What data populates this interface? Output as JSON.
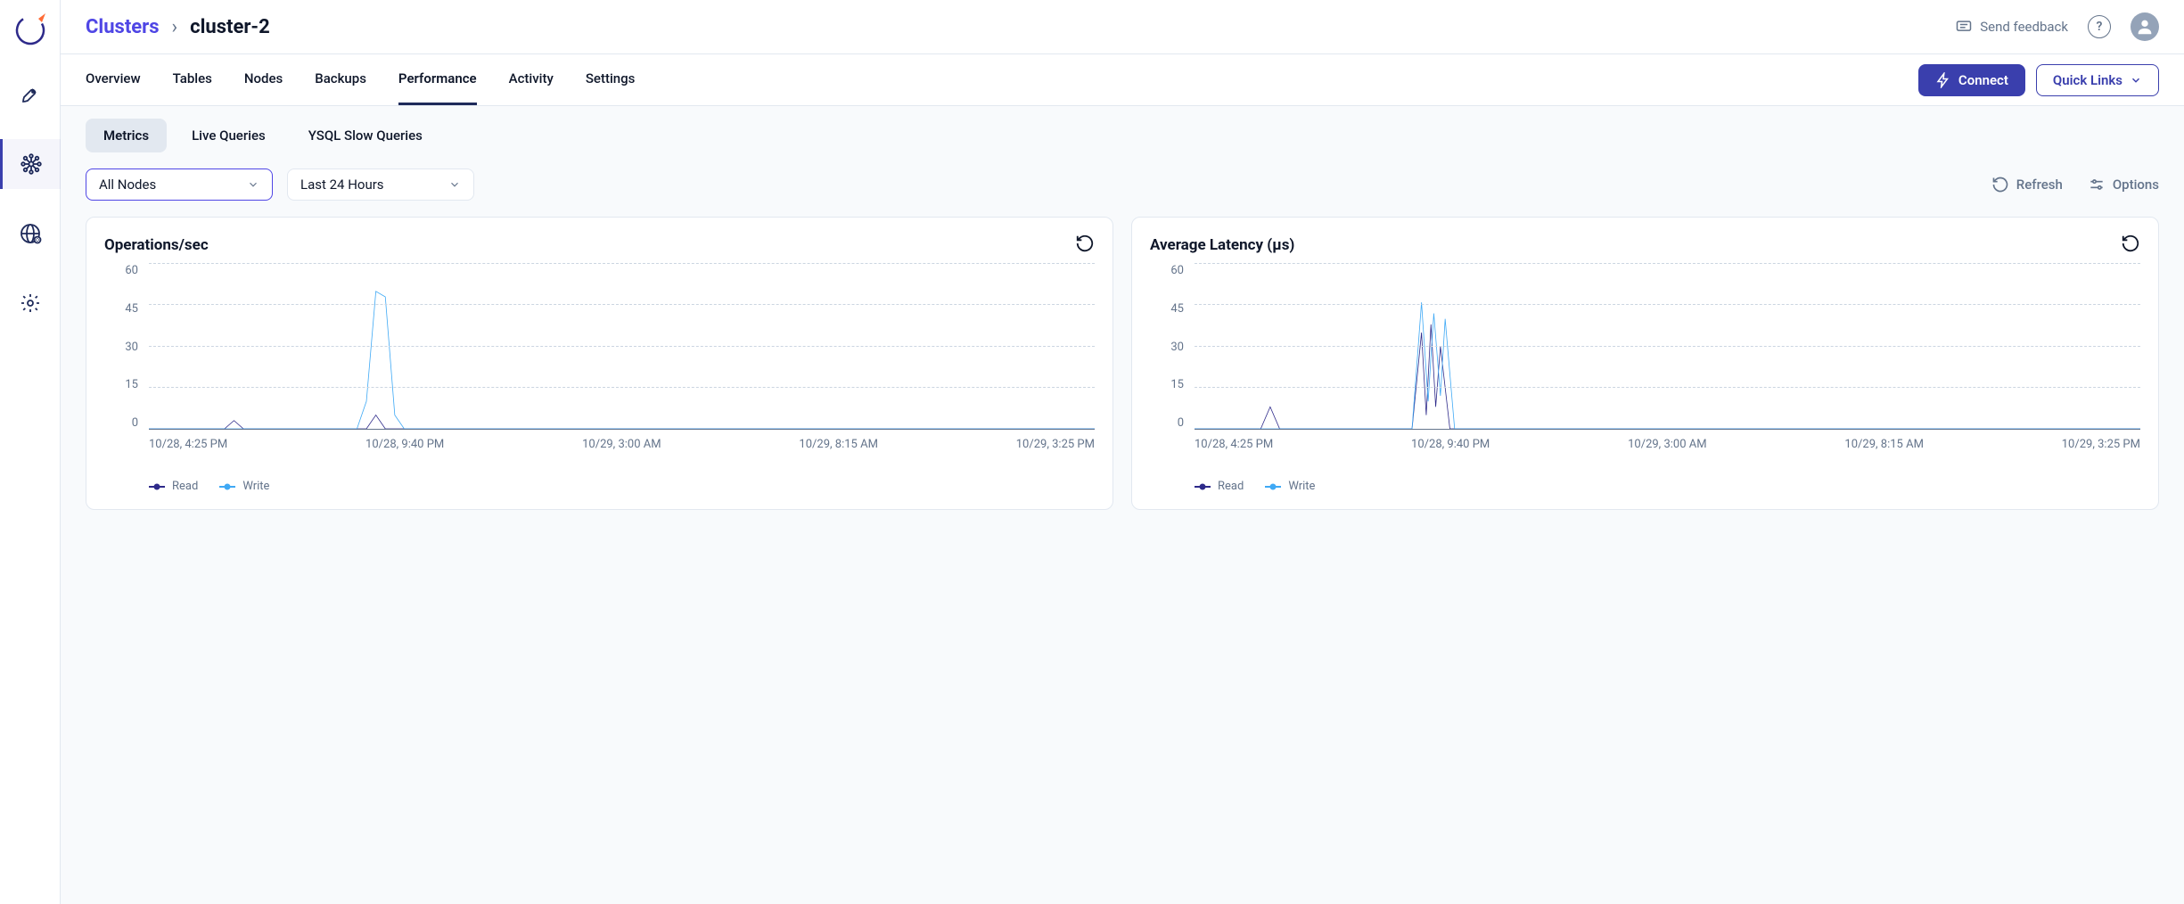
{
  "breadcrumb": {
    "root": "Clusters",
    "current": "cluster-2"
  },
  "header": {
    "feedback": "Send feedback",
    "connect": "Connect",
    "quick_links": "Quick Links"
  },
  "tabs_main": {
    "items": [
      "Overview",
      "Tables",
      "Nodes",
      "Backups",
      "Performance",
      "Activity",
      "Settings"
    ],
    "active_index": 4
  },
  "perf_tabs": {
    "items": [
      "Metrics",
      "Live Queries",
      "YSQL Slow Queries"
    ],
    "active_index": 0
  },
  "filters": {
    "nodes": "All Nodes",
    "time": "Last 24 Hours",
    "refresh": "Refresh",
    "options": "Options"
  },
  "charts": [
    {
      "title": "Operations/sec"
    },
    {
      "title": "Average Latency (µs)"
    }
  ],
  "legend": {
    "read": "Read",
    "write": "Write"
  },
  "colors": {
    "read": "#2E2A8A",
    "write": "#3FA9F5"
  },
  "chart_data": [
    {
      "type": "line",
      "title": "Operations/sec",
      "xlabel": "",
      "ylabel": "",
      "ylim": [
        0,
        60
      ],
      "y_ticks": [
        0,
        15,
        30,
        45,
        60
      ],
      "x_ticks": [
        "10/28, 4:25 PM",
        "10/28, 9:40 PM",
        "10/29, 3:00 AM",
        "10/29, 8:15 AM",
        "10/29, 3:25 PM"
      ],
      "series": [
        {
          "name": "Read",
          "color": "#2E2A8A",
          "points": [
            [
              0,
              0
            ],
            [
              8,
              0
            ],
            [
              9,
              3
            ],
            [
              10,
              0
            ],
            [
              23,
              0
            ],
            [
              24,
              5
            ],
            [
              25,
              0
            ],
            [
              100,
              0
            ]
          ]
        },
        {
          "name": "Write",
          "color": "#3FA9F5",
          "points": [
            [
              0,
              0
            ],
            [
              22,
              0
            ],
            [
              23,
              10
            ],
            [
              24,
              50
            ],
            [
              25,
              48
            ],
            [
              26,
              5
            ],
            [
              27,
              0
            ],
            [
              100,
              0
            ]
          ]
        }
      ]
    },
    {
      "type": "line",
      "title": "Average Latency (µs)",
      "xlabel": "",
      "ylabel": "",
      "ylim": [
        0,
        60
      ],
      "y_ticks": [
        0,
        15,
        30,
        45,
        60
      ],
      "x_ticks": [
        "10/28, 4:25 PM",
        "10/28, 9:40 PM",
        "10/29, 3:00 AM",
        "10/29, 8:15 AM",
        "10/29, 3:25 PM"
      ],
      "series": [
        {
          "name": "Read",
          "color": "#2E2A8A",
          "points": [
            [
              0,
              0
            ],
            [
              7,
              0
            ],
            [
              8,
              8
            ],
            [
              9,
              0
            ],
            [
              23,
              0
            ],
            [
              24,
              35
            ],
            [
              24.5,
              5
            ],
            [
              25,
              38
            ],
            [
              25.5,
              8
            ],
            [
              26,
              30
            ],
            [
              27,
              0
            ],
            [
              100,
              0
            ]
          ]
        },
        {
          "name": "Write",
          "color": "#3FA9F5",
          "points": [
            [
              0,
              0
            ],
            [
              23,
              0
            ],
            [
              24,
              46
            ],
            [
              24.7,
              10
            ],
            [
              25.3,
              42
            ],
            [
              26,
              12
            ],
            [
              26.5,
              40
            ],
            [
              27.5,
              0
            ],
            [
              100,
              0
            ]
          ]
        }
      ]
    }
  ]
}
